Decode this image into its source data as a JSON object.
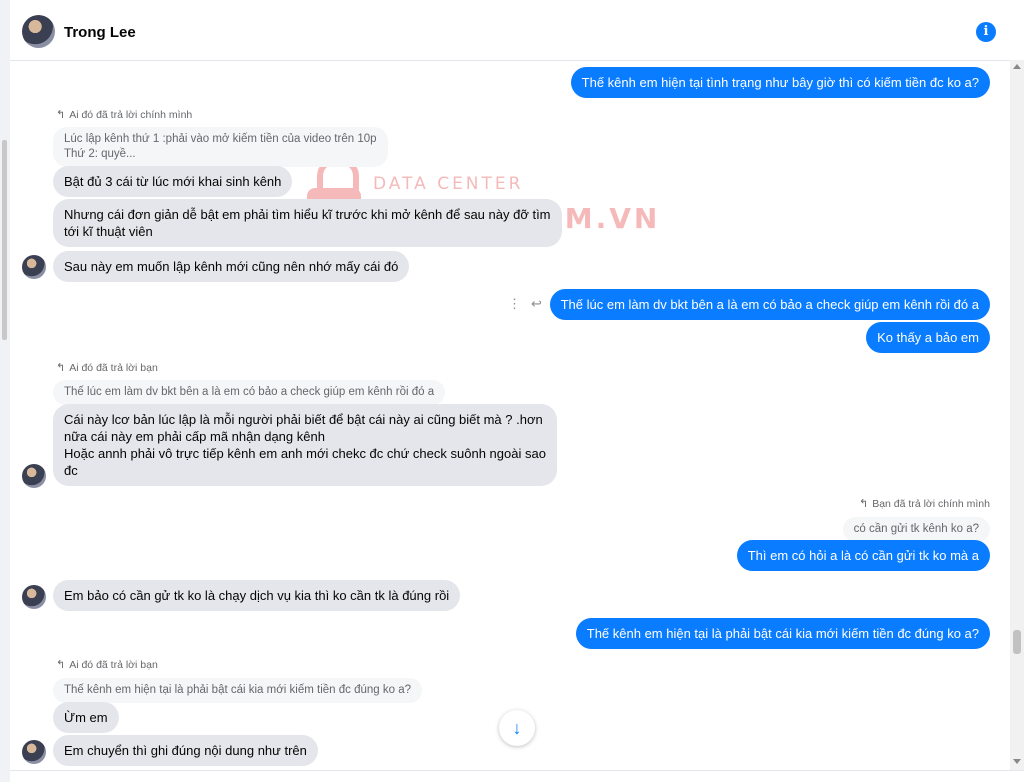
{
  "header": {
    "contact_name": "Trong Lee",
    "info_icon": "info-icon"
  },
  "watermark": {
    "line1": "DATA CENTER",
    "line2": "CHECKSCAM.VN"
  },
  "messages": {
    "m1": "Thế kênh em hiện tại tình trạng như bây giờ thì có kiếm tiền đc ko a?",
    "r1_label": "Ai đó đã trả lời chính mình",
    "r1_quote_l1": "Lúc lập kênh thứ 1 :phải vào mở kiếm tiền của video trên 10p",
    "r1_quote_l2": "Thứ 2: quyề...",
    "m2": "Bật đủ 3 cái từ lúc mới khai sinh kênh",
    "m3_l1": "Nhưng cái đơn giản dễ bật em phải tìm hiểu kĩ trước khi mở kênh để sau này đỡ tìm",
    "m3_l2": "tới kĩ thuật viên",
    "m4": "Sau này em muốn lập kênh mới cũng nên nhớ mấy cái đó",
    "m5": "Thế lúc em làm dv bkt bên a là em có bảo a check giúp em kênh rồi đó a",
    "m6": "Ko thấy a bảo em",
    "r2_label": "Ai đó đã trả lời bạn",
    "r2_quote": "Thế lúc em làm dv bkt bên a là em có bảo a check giúp em kênh rồi đó a",
    "m7_l1": "Cái này lcơ bản lúc lập là mỗi người phải biết để bật cái này ai cũng biết mà ? .hơn",
    "m7_l2": "nữa cái này em phải cấp mã nhận dạng kênh",
    "m7_l3": "Hoặc annh phải vô trực tiếp kênh em anh mới chekc đc chứ check suônh ngoài sao",
    "m7_l4": "đc",
    "r3_label": "Bạn đã trả lời chính mình",
    "r3_quote": "có cần gửi tk kênh ko a?",
    "m8": "Thì em có hỏi a là có cần gửi tk ko mà a",
    "m9": "Em bảo có cần gử tk ko là chạy dịch vụ kia thì ko cần tk là đúng rồi",
    "m10": "Thế kênh em hiện tại là phải bật cái kia mới kiếm tiền đc đúng ko a?",
    "r4_label": "Ai đó đã trả lời bạn",
    "r4_quote": "Thế kênh em hiện tại là phải bật cái kia mới kiếm tiền đc đúng ko a?",
    "m11": "Ừm em",
    "m12": "Em chuyển thì ghi đúng nội dung như trên"
  },
  "colors": {
    "accent": "#0a7cff",
    "incoming_bubble": "#e4e6eb",
    "watermark": "#f08080"
  }
}
